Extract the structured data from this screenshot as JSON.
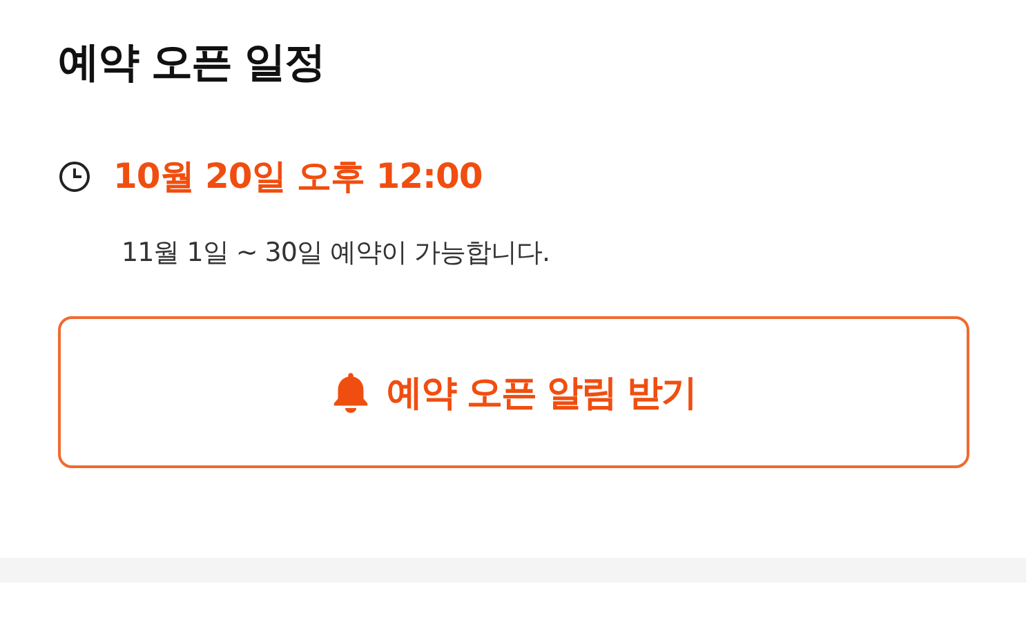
{
  "section": {
    "title": "예약 오픈 일정"
  },
  "schedule": {
    "time": "10월 20일 오후 12:00",
    "note": "11월 1일 ~ 30일 예약이 가능합니다."
  },
  "button": {
    "label": "예약 오픈 알림 받기"
  }
}
